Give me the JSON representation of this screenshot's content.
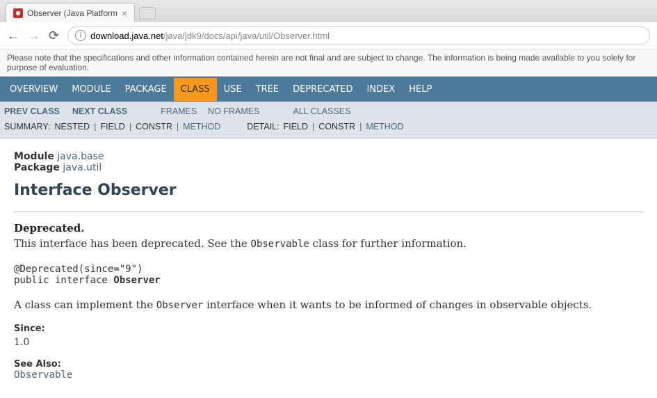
{
  "browser": {
    "tab_title": "Observer (Java Platform",
    "url_host": "download.java.net",
    "url_path": "/java/jdk9/docs/api/java/util/Observer.html"
  },
  "notice": "Please note that the specifications and other information contained herein are not final and are subject to change. The information is being made available to you solely for purpose of evaluation.",
  "topnav": {
    "overview": "OVERVIEW",
    "module": "MODULE",
    "package": "PACKAGE",
    "class": "CLASS",
    "use": "USE",
    "tree": "TREE",
    "deprecated": "DEPRECATED",
    "index": "INDEX",
    "help": "HELP"
  },
  "subnav": {
    "prev_class": "PREV CLASS",
    "next_class": "NEXT CLASS",
    "frames": "FRAMES",
    "no_frames": "NO FRAMES",
    "all_classes": "ALL CLASSES",
    "summary_label": "SUMMARY:",
    "nested": "NESTED",
    "field": "FIELD",
    "constr": "CONSTR",
    "method": "METHOD",
    "detail_label": "DETAIL:",
    "detail_field": "FIELD",
    "detail_constr": "CONSTR",
    "detail_method": "METHOD"
  },
  "content": {
    "module_label": "Module",
    "module_link": "java.base",
    "package_label": "Package",
    "package_link": "java.util",
    "heading": "Interface Observer",
    "deprecated_title": "Deprecated.",
    "deprecated_text_1": "This interface has been deprecated. See the ",
    "deprecated_code": "Observable",
    "deprecated_text_2": " class for further information.",
    "signature_line1": "@Deprecated(since=\"9\")",
    "signature_line2a": "public interface ",
    "signature_line2b": "Observer",
    "description_1": "A class can implement the ",
    "description_code": "Observer",
    "description_2": " interface when it wants to be informed of changes in observable objects.",
    "since_label": "Since:",
    "since_value": "1.0",
    "seealso_label": "See Also:",
    "seealso_link": "Observable"
  }
}
